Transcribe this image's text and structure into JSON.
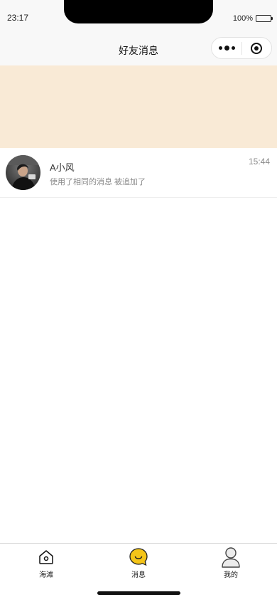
{
  "status_bar": {
    "time": "23:17",
    "battery_text": "100%",
    "battery_level": 1.0
  },
  "nav": {
    "title": "好友消息",
    "capsule": {
      "more_icon": "more-dots-icon",
      "close_icon": "target-circle-icon"
    }
  },
  "banner": {
    "color": "#f9ead6"
  },
  "messages": [
    {
      "name": "A小风",
      "preview": "使用了相同的消息 被追加了",
      "time": "15:44",
      "avatar_icon": "user-photo-avatar"
    }
  ],
  "tab_bar": {
    "items": [
      {
        "label": "海滩",
        "icon": "home-icon",
        "active": false
      },
      {
        "label": "消息",
        "icon": "smile-chat-icon",
        "active": true
      },
      {
        "label": "我的",
        "icon": "person-icon",
        "active": false
      }
    ]
  },
  "colors": {
    "accent": "#f5c518",
    "banner": "#f9ead6",
    "nav_bg": "#f8f8f8"
  }
}
